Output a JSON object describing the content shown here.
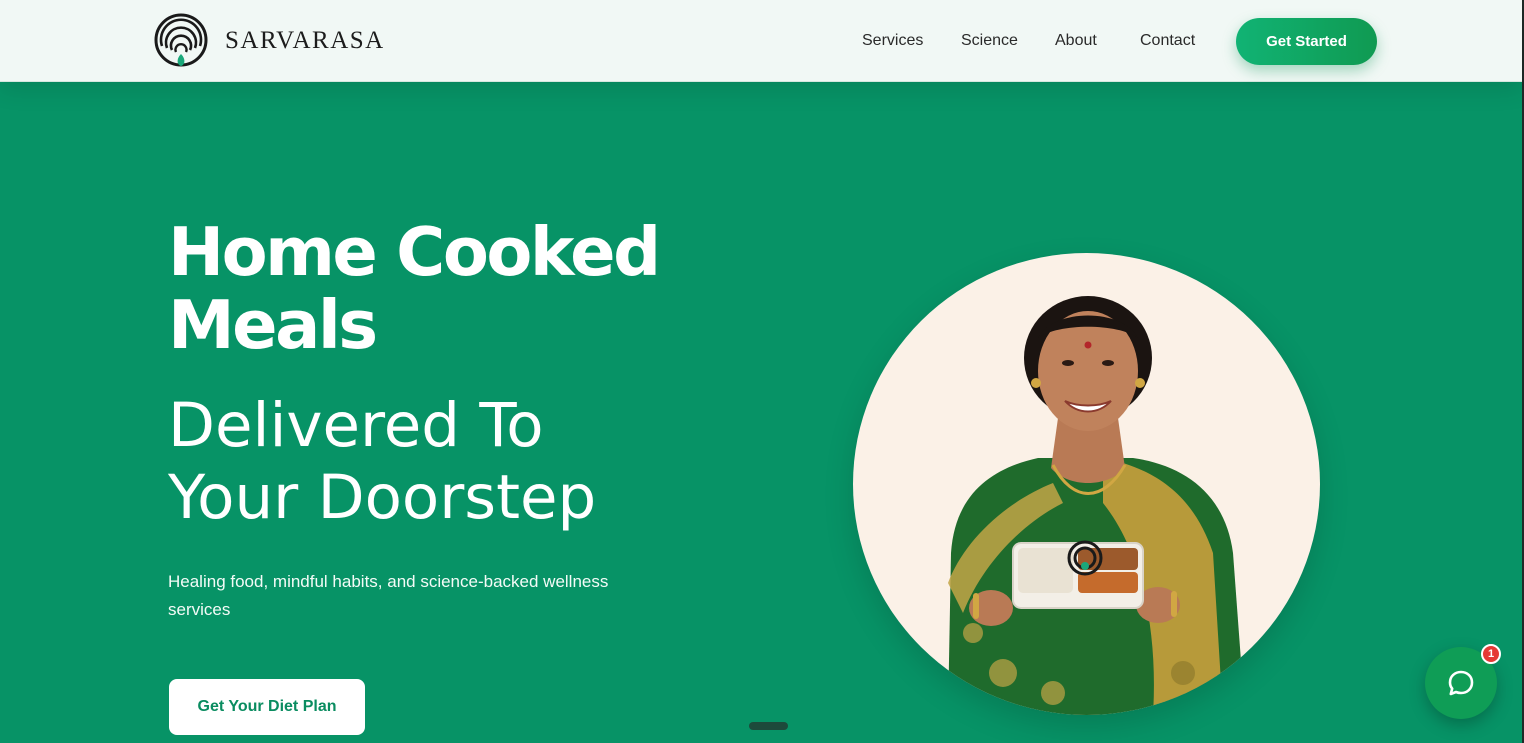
{
  "header": {
    "brand": "SARVARASA",
    "nav": [
      "Services",
      "Science",
      "About",
      "Contact"
    ],
    "cta_label": "Get Started"
  },
  "hero": {
    "title_line1": "Home Cooked",
    "title_line2": "Meals",
    "subtitle_line1": "Delivered To",
    "subtitle_line2": "Your Doorstep",
    "description": "Healing food, mindful habits, and science-backed wellness services",
    "button_label": "Get Your Diet Plan"
  },
  "chat": {
    "badge_count": "1"
  },
  "colors": {
    "hero_bg": "#079366",
    "header_bg": "#f1f8f5",
    "accent": "#11b374",
    "chat": "#0f9d56",
    "badge": "#e53935"
  },
  "icons": [
    "brand-logo-icon",
    "chat-icon"
  ]
}
